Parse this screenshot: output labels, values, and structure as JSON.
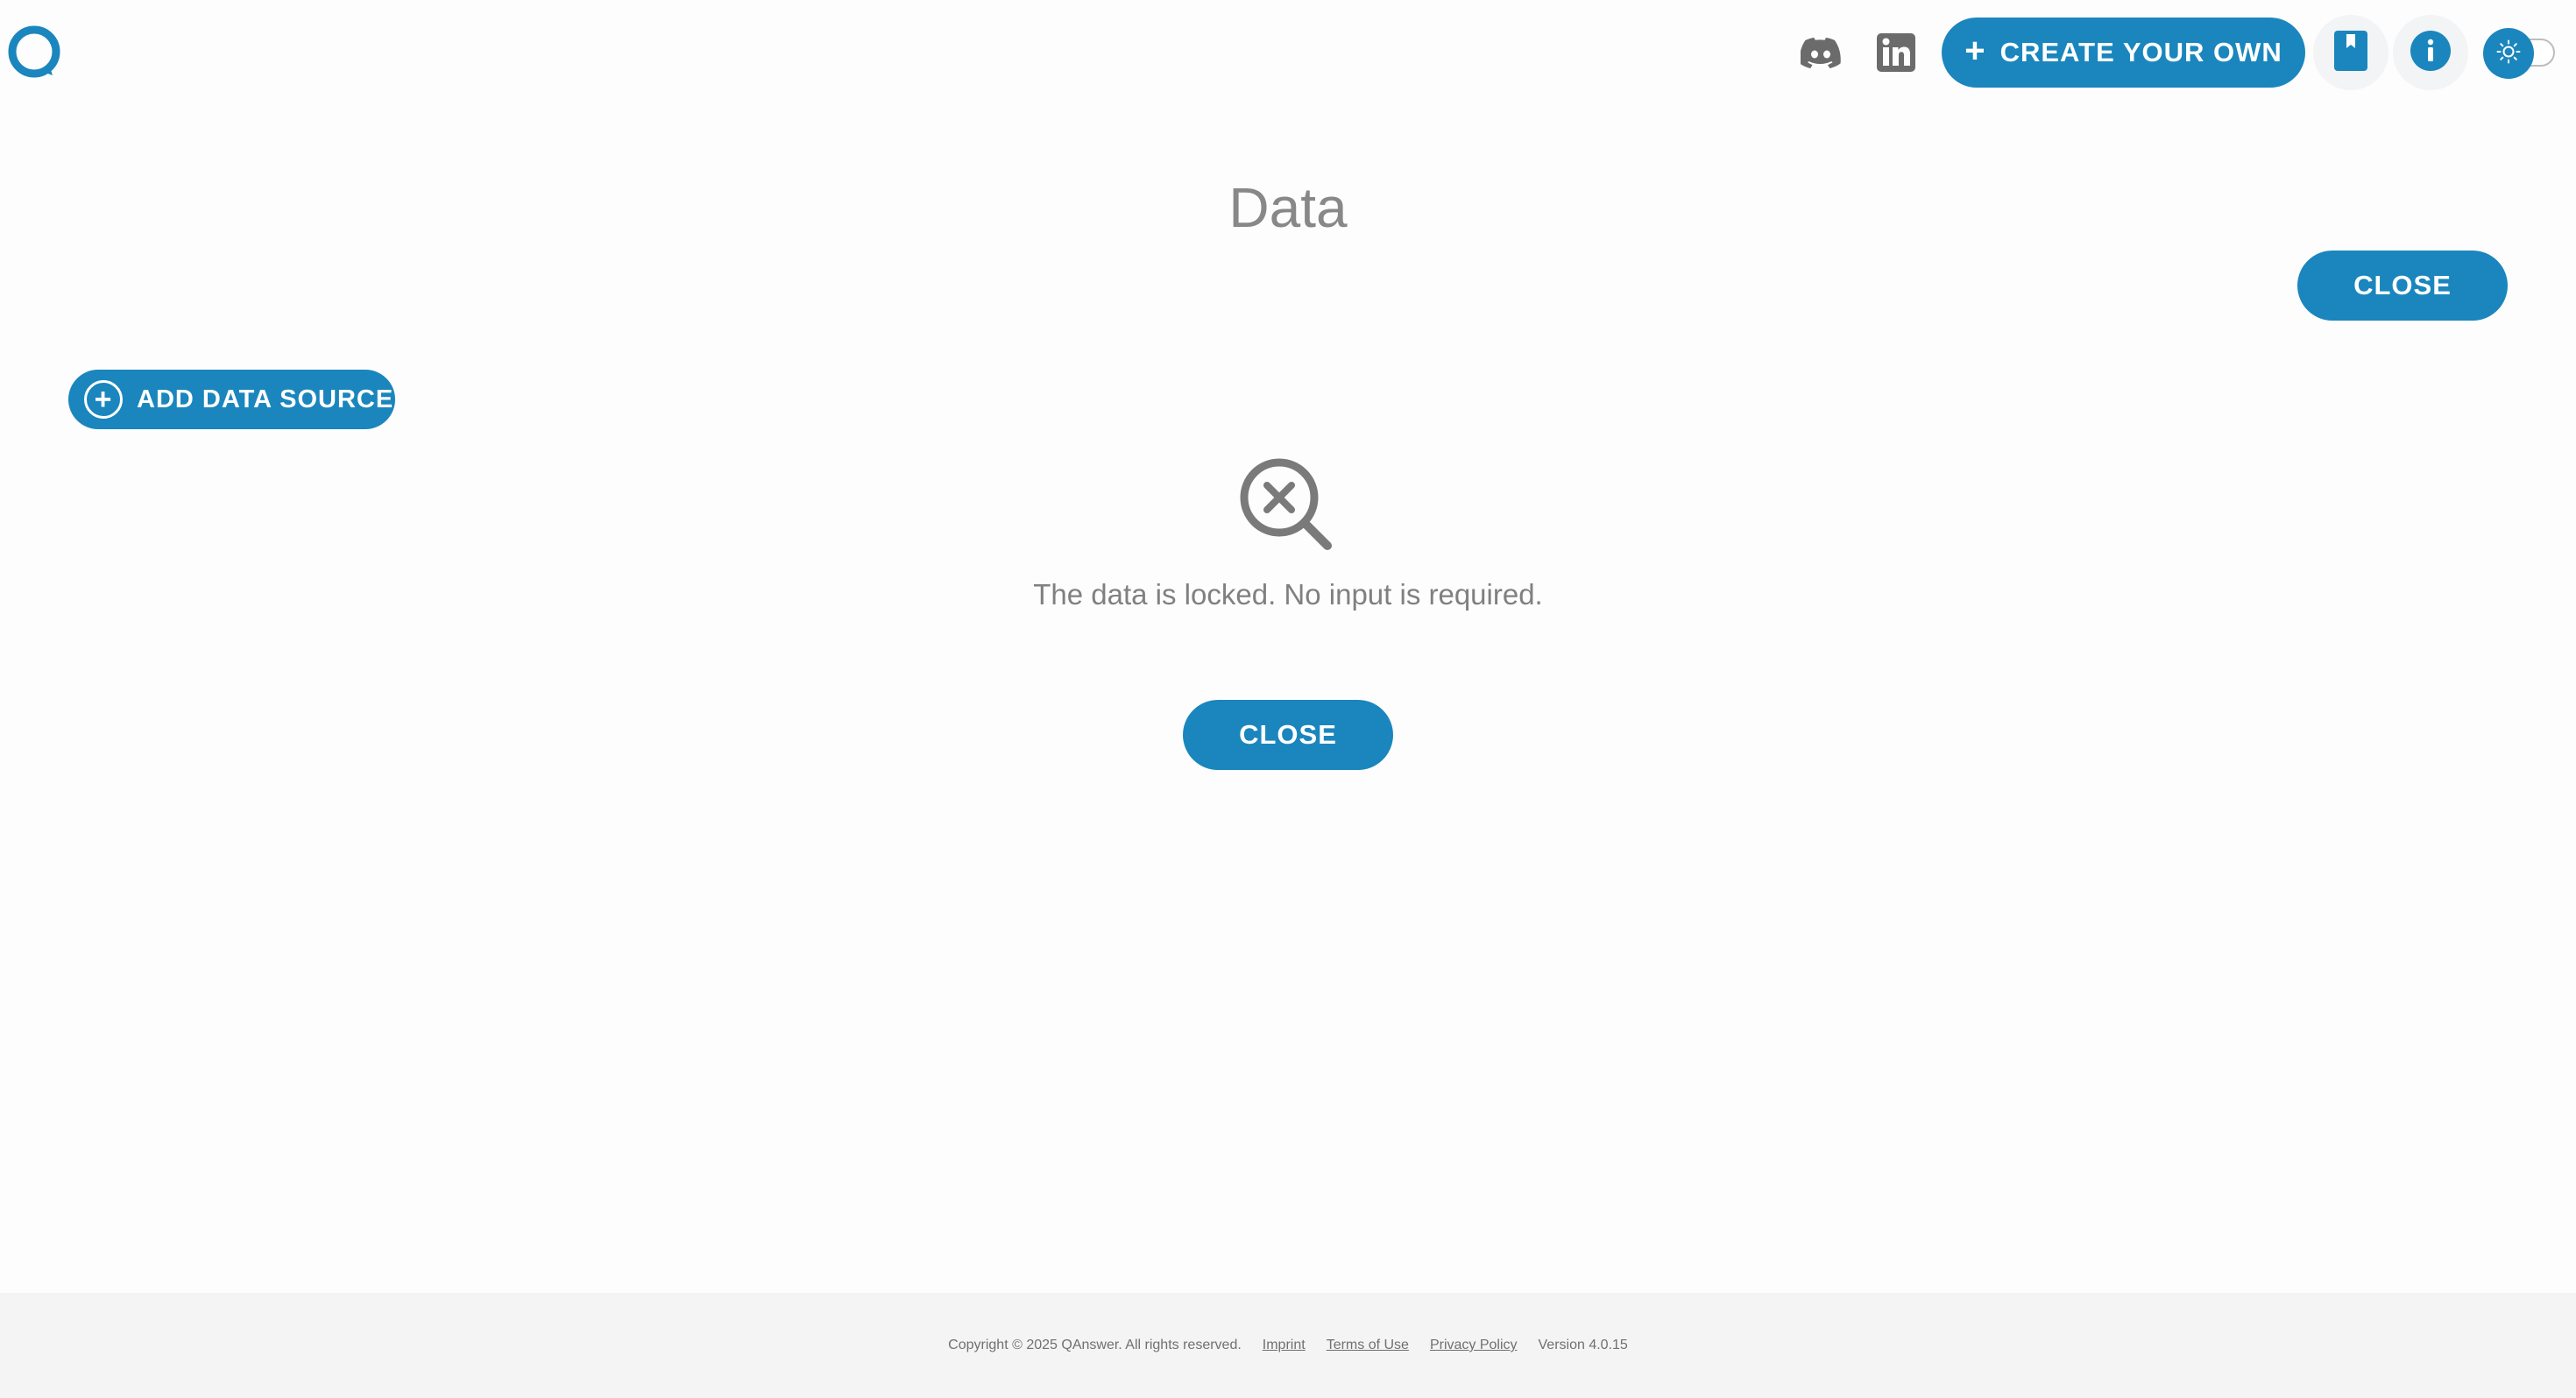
{
  "header": {
    "logo_icon": "qanswer-logo-icon",
    "discord_icon": "discord-icon",
    "linkedin_icon": "linkedin-icon",
    "create_label": "CREATE YOUR OWN",
    "bookmark_icon": "bookmark-icon",
    "info_icon": "info-icon",
    "theme_icon": "sun-icon"
  },
  "main": {
    "title": "Data",
    "close_top_label": "CLOSE",
    "add_source_label": "ADD DATA SOURCE",
    "empty_icon": "search-off-icon",
    "empty_message": "The data is locked. No input is required.",
    "close_center_label": "CLOSE"
  },
  "footer": {
    "copyright": "Copyright © 2025 QAnswer. All rights reserved.",
    "imprint": "Imprint",
    "terms": "Terms of Use",
    "privacy": "Privacy Policy",
    "version": "Version 4.0.15"
  },
  "colors": {
    "accent": "#1a86bd",
    "text_muted": "#888888",
    "icon_gray": "#6b6b6b",
    "footer_bg": "#f4f4f4"
  }
}
